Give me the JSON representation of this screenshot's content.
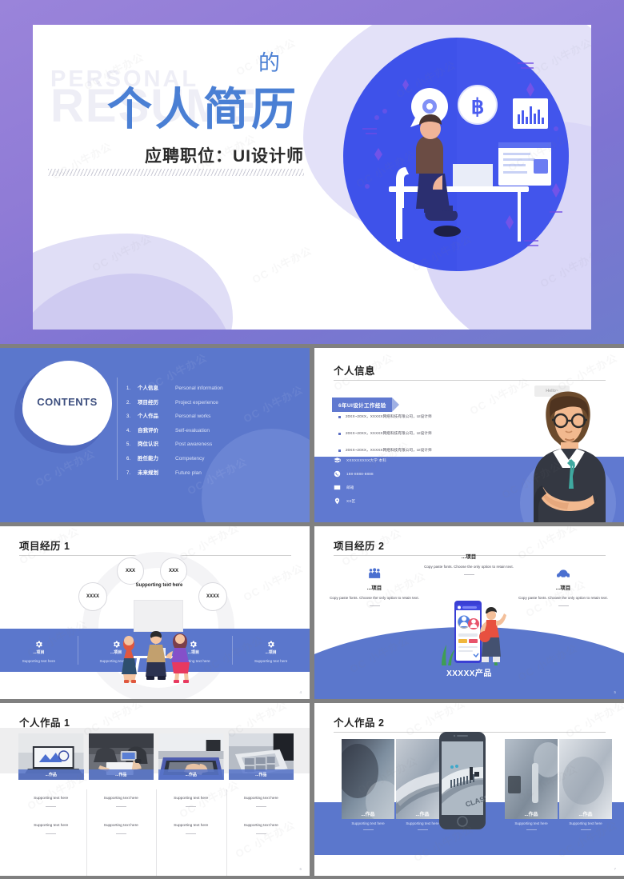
{
  "theme": {
    "purple": "#8f7bd6",
    "blue": "#5b77cc",
    "title_blue": "#4a7fd4",
    "deep_blue": "#6079d0",
    "watermark_text": "OC 小牛办公"
  },
  "cover": {
    "ghost_line1": "PERSONAL",
    "ghost_line2": "RESUME",
    "de": "的",
    "title": "个人简历",
    "subtitle": "应聘职位：UI设计师"
  },
  "contents": {
    "heading": "CONTENTS",
    "items": [
      {
        "num": "1.",
        "cn": "个人信息",
        "en": "Personal information"
      },
      {
        "num": "2.",
        "cn": "项目经历",
        "en": "Project experience"
      },
      {
        "num": "3.",
        "cn": "个人作品",
        "en": "Personal works"
      },
      {
        "num": "4.",
        "cn": "自我评价",
        "en": "Self-evaluation"
      },
      {
        "num": "5.",
        "cn": "岗位认识",
        "en": "Post awareness"
      },
      {
        "num": "6.",
        "cn": "胜任能力",
        "en": "Competency"
      },
      {
        "num": "7.",
        "cn": "未来规划",
        "en": "Future plan"
      }
    ]
  },
  "personal_info": {
    "title": "个人信息",
    "hello": "Hello~",
    "ribbon": "6年UI设计工作经验",
    "experience": [
      "20XX~20XX，XXXXX网络科技有限公司，UI设计师",
      "20XX~20XX，XXXXX网络科技有限公司，UI设计师",
      "20XX~20XX，XXXXX网络科技有限公司，UI设计师"
    ],
    "contacts": [
      {
        "icon": "graduation-cap-icon",
        "text": "XXXXXXXXX大学   本科"
      },
      {
        "icon": "phone-icon",
        "text": "188-8888-8888"
      },
      {
        "icon": "mail-icon",
        "text": "邮箱"
      },
      {
        "icon": "location-icon",
        "text": "XX区"
      }
    ]
  },
  "project1": {
    "title": "项目经历 1",
    "bubbles": [
      "XXX",
      "XXX",
      "XXXX",
      "XXXX"
    ],
    "supporting": "Supporting text here",
    "columns": [
      {
        "label": "...项目",
        "text": "Supporting text here"
      },
      {
        "label": "...项目",
        "text": "Supporting text here"
      },
      {
        "label": "...项目",
        "text": "Supporting text here"
      },
      {
        "label": "...项目",
        "text": "Supporting text here"
      }
    ],
    "page": "4"
  },
  "project2": {
    "title": "项目经历 2",
    "product": "XXXXX产品",
    "blocks": [
      {
        "icon": "people-icon",
        "label": "...项目",
        "text": "Copy paste fonts. Choose the only option to retain text."
      },
      {
        "icon": "none",
        "label": "...项目",
        "text": "Copy paste fonts. Choose the only option to retain text."
      },
      {
        "icon": "cloud-icon",
        "label": "...项目",
        "text": "Copy paste fonts. Choose the only option to retain text."
      }
    ],
    "page": "5"
  },
  "works1": {
    "title": "个人作品 1",
    "cells": [
      {
        "caption": "...作品",
        "t1": "Supporting text here",
        "t2": "Supporting text here"
      },
      {
        "caption": "...作品",
        "t1": "Supporting text here",
        "t2": "Supporting text here"
      },
      {
        "caption": "...作品",
        "t1": "Supporting text here",
        "t2": "Supporting text here"
      },
      {
        "caption": "...作品",
        "t1": "Supporting text here",
        "t2": "Supporting text here"
      }
    ],
    "page": "6"
  },
  "works2": {
    "title": "个人作品 2",
    "phone_text": "CLASS",
    "caps": [
      {
        "label": "...作品",
        "text": "Supporting text here"
      },
      {
        "label": "...作品",
        "text": "Supporting text here"
      },
      {
        "label": "...作品",
        "text": "Supporting text here"
      },
      {
        "label": "...作品",
        "text": "Supporting text here"
      }
    ],
    "page": "7"
  }
}
